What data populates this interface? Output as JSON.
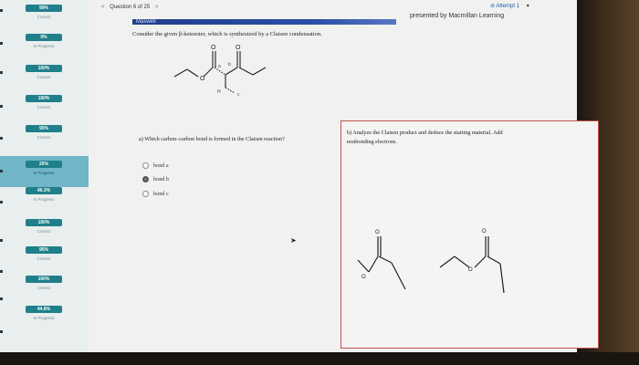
{
  "sidebar": {
    "items": [
      {
        "percent": "99%",
        "status": "Correct",
        "active": false
      },
      {
        "percent": "0%",
        "status": "In Progress",
        "active": false
      },
      {
        "percent": "100%",
        "status": "Correct",
        "active": false
      },
      {
        "percent": "100%",
        "status": "Correct",
        "active": false
      },
      {
        "percent": "95%",
        "status": "Correct",
        "active": false
      },
      {
        "percent": "25%",
        "status": "In Progress",
        "active": true
      },
      {
        "percent": "49.3%",
        "status": "In Progress",
        "active": false
      },
      {
        "percent": "100%",
        "status": "Correct",
        "active": false
      },
      {
        "percent": "95%",
        "status": "Correct",
        "active": false
      },
      {
        "percent": "100%",
        "status": "Correct",
        "active": false
      },
      {
        "percent": "44.8%",
        "status": "In Progress",
        "active": false
      }
    ]
  },
  "header": {
    "question_label": "Question 6 of 25",
    "prev": "<",
    "next": ">",
    "attempt": "Attempt 1",
    "presented_by": "presented by Macmillan Learning",
    "brand": "Maxwell"
  },
  "question": {
    "prompt": "Consider the given β-ketoester, which is synthesized by a Claisen condensation.",
    "molecule_labels": {
      "bond_a": "a",
      "bond_b": "b",
      "bond_c": "c",
      "h": "H"
    },
    "part_a": {
      "text": "a) Which carbon–carbon bond is formed in the Claisen reaction?",
      "options": [
        {
          "label": "bond a",
          "selected": false
        },
        {
          "label": "bond b",
          "selected": true
        },
        {
          "label": "bond c",
          "selected": false
        }
      ]
    },
    "part_b": {
      "text": "b) Analyze the Claisen product and deduce the starting material. Add nonbonding electrons."
    }
  },
  "colors": {
    "sidebar_active": "#6fb6c9",
    "pill": "#1f7f8a",
    "brand": "#2a4fa6",
    "box_border": "#c0524e"
  }
}
